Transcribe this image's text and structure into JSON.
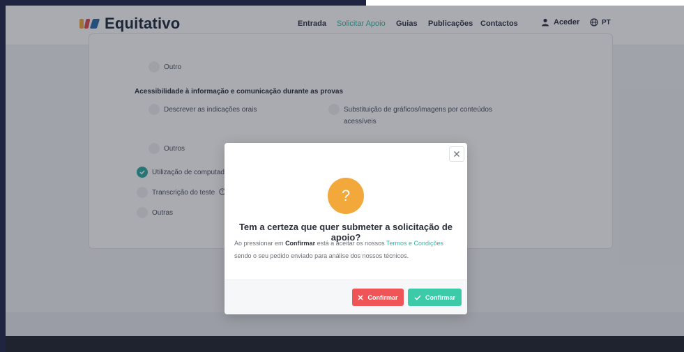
{
  "brand": {
    "name": "Equitativo"
  },
  "nav": {
    "items": [
      "Entrada",
      "Solicitar Apoio",
      "Guias",
      "Publicações",
      "Contactos"
    ],
    "user_label": "Aceder",
    "lang_label": "PT"
  },
  "form": {
    "opt_outro": "Outro",
    "section_title": "Acessibilidade à informação e comunicação durante as provas",
    "opt_descrever": "Descrever as indicações orais",
    "opt_substituicao": "Substituição de gráficos/imagens por conteúdos acessíveis",
    "opt_outros": "Outros",
    "opt_utilizacao": "Utilização de computado",
    "opt_transcricao": "Transcrição do teste",
    "opt_outras": "Outras"
  },
  "modal": {
    "icon_symbol": "?",
    "title": "Tem a certeza que quer submeter a solicitação de apoio?",
    "body_prefix": "Ao pressionar em",
    "body_bold": "Confirmar",
    "body_mid": "está a aceitar os nossos",
    "body_link": "Termos e Condições",
    "body_suffix": "sendo o seu pedido enviado para análise dos nossos técnicos.",
    "cancel_label": "Confirmar",
    "confirm_label": "Confirmar"
  },
  "colors": {
    "accent": "#2fb7a6",
    "warning": "#f3a83b",
    "danger": "#ef5557",
    "success": "#3ccaa9"
  },
  "icons": [
    "user-icon",
    "globe-icon",
    "close-icon",
    "question-icon",
    "check-icon",
    "x-icon",
    "help-icon"
  ]
}
